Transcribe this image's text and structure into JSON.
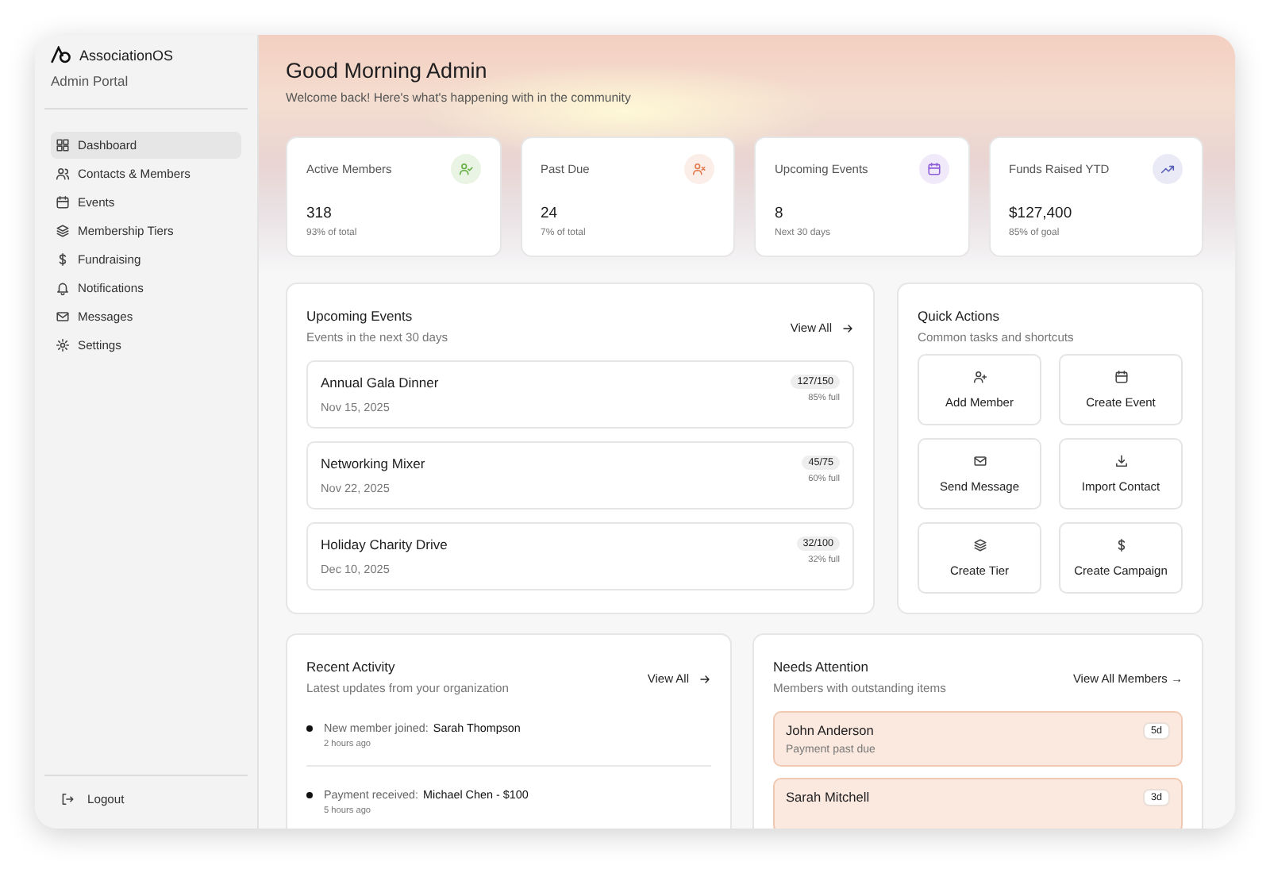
{
  "sidebar": {
    "brand": "AssociationOS",
    "subtitle": "Admin Portal",
    "items": [
      {
        "label": "Dashboard",
        "selected": true
      },
      {
        "label": "Contacts & Members",
        "selected": false
      },
      {
        "label": "Events",
        "selected": false
      },
      {
        "label": "Membership Tiers",
        "selected": false
      },
      {
        "label": "Fundraising",
        "selected": false
      },
      {
        "label": "Notifications",
        "selected": false
      },
      {
        "label": "Messages",
        "selected": false
      },
      {
        "label": "Settings",
        "selected": false
      }
    ],
    "logout": "Logout"
  },
  "header": {
    "title": "Good Morning Admin",
    "subtitle": "Welcome back! Here's what's happening with in the community"
  },
  "stats": [
    {
      "label": "Active Members",
      "value": "318",
      "note": "93% of total",
      "color": "#5fae3e"
    },
    {
      "label": "Past Due",
      "value": "24",
      "note": "7% of total",
      "color": "#e0784a"
    },
    {
      "label": "Upcoming Events",
      "value": "8",
      "note": "Next 30 days",
      "color": "#8b5cd6"
    },
    {
      "label": "Funds Raised YTD",
      "value": "$127,400",
      "note": "85% of goal",
      "color": "#5a5fb8"
    }
  ],
  "upcoming_events": {
    "title": "Upcoming Events",
    "subtitle": "Events in the next 30 days",
    "link": "View All",
    "events": [
      {
        "name": "Annual Gala Dinner",
        "date": "Nov 15, 2025",
        "count": "127/150",
        "fill": "85% full"
      },
      {
        "name": "Networking Mixer",
        "date": "Nov 22, 2025",
        "count": "45/75",
        "fill": "60% full"
      },
      {
        "name": "Holiday Charity Drive",
        "date": "Dec 10, 2025",
        "count": "32/100",
        "fill": "32% full"
      }
    ]
  },
  "quick_actions": {
    "title": "Quick Actions",
    "subtitle": "Common tasks and shortcuts",
    "actions": [
      "Add Member",
      "Create Event",
      "Send Message",
      "Import Contact",
      "Create Tier",
      "Create Campaign"
    ]
  },
  "recent_activity": {
    "title": "Recent Activity",
    "subtitle": "Latest updates from your organization",
    "link": "View All",
    "items": [
      {
        "action": "New member joined:",
        "subject": "Sarah Thompson",
        "time": "2 hours ago"
      },
      {
        "action": "Payment received:",
        "subject": "Michael Chen - $100",
        "time": "5 hours ago"
      }
    ]
  },
  "needs_attention": {
    "title": "Needs Attention",
    "subtitle": "Members with outstanding items",
    "link": "View All Members →",
    "members": [
      {
        "name": "John Anderson",
        "issue": "Payment past due",
        "days": "5d"
      },
      {
        "name": "Sarah Mitchell",
        "days": "3d"
      }
    ]
  }
}
